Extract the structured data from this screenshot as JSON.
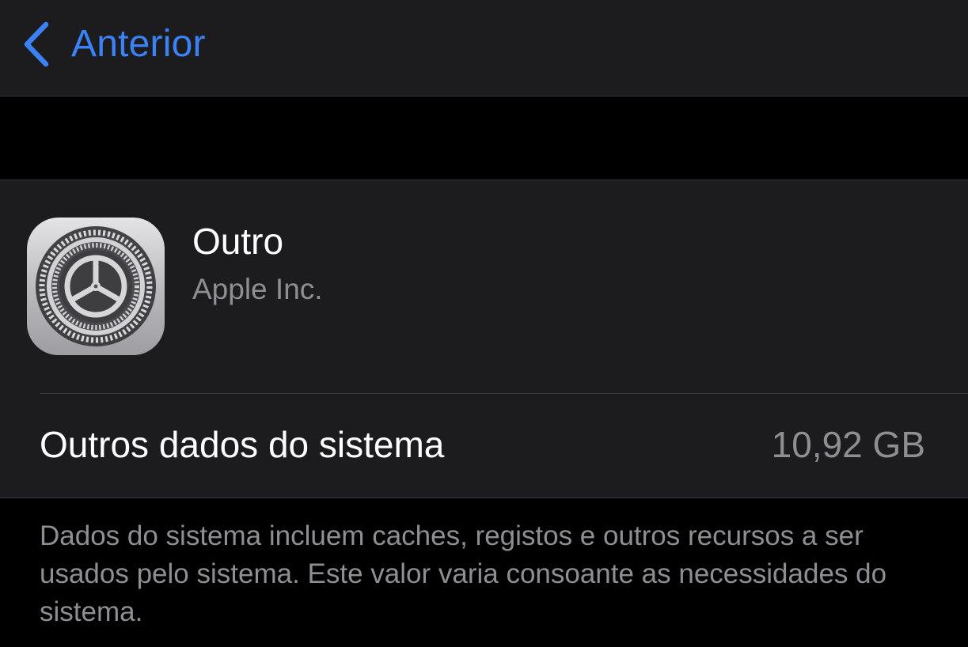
{
  "navbar": {
    "back_label": "Anterior",
    "back_icon": "chevron-left-icon",
    "accent_color": "#3b82f6"
  },
  "app": {
    "icon": "settings-gear-icon",
    "name": "Outro",
    "vendor": "Apple Inc."
  },
  "system_data": {
    "label": "Outros dados do sistema",
    "value": "10,92 GB"
  },
  "footer": {
    "description": "Dados do sistema incluem caches, registos e outros recursos a ser usados pelo sistema. Este valor varia consoante as necessidades do sistema."
  }
}
